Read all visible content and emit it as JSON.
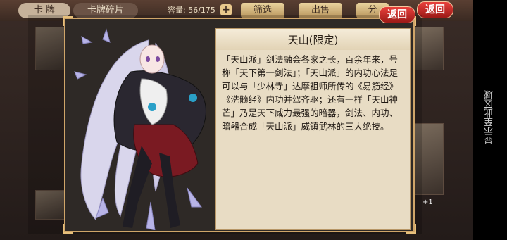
{
  "top_bar": {
    "tab_cards": "卡 牌",
    "tab_fragments": "卡牌碎片",
    "capacity_label": "容量:",
    "capacity_value": "56/175",
    "add_symbol": "+",
    "filter_label": "筛选",
    "sell_label": "出售",
    "split_label": "分",
    "back_label": "返回",
    "back_label_2": "返回"
  },
  "card": {
    "name": "天山(限定)",
    "description": "「天山派」剑法融会各家之长，百余年来，号称「天下第一剑法」；「天山派」的内功心法足可以与「少林寺」达摩祖师所传的《易筋经》《洗髓经》内功并驾齐驱；还有一样「天山神芒」乃是天下威力最强的暗器，剑法、内功、暗器合成「天山派」威镇武林的三大绝技。"
  },
  "side_badge": "+1",
  "sidebar_text": "显示至此区域",
  "colors": {
    "frame_gold": "#cfa569",
    "panel_bg": "#e8dcc4",
    "back_red": "#d4302b"
  }
}
